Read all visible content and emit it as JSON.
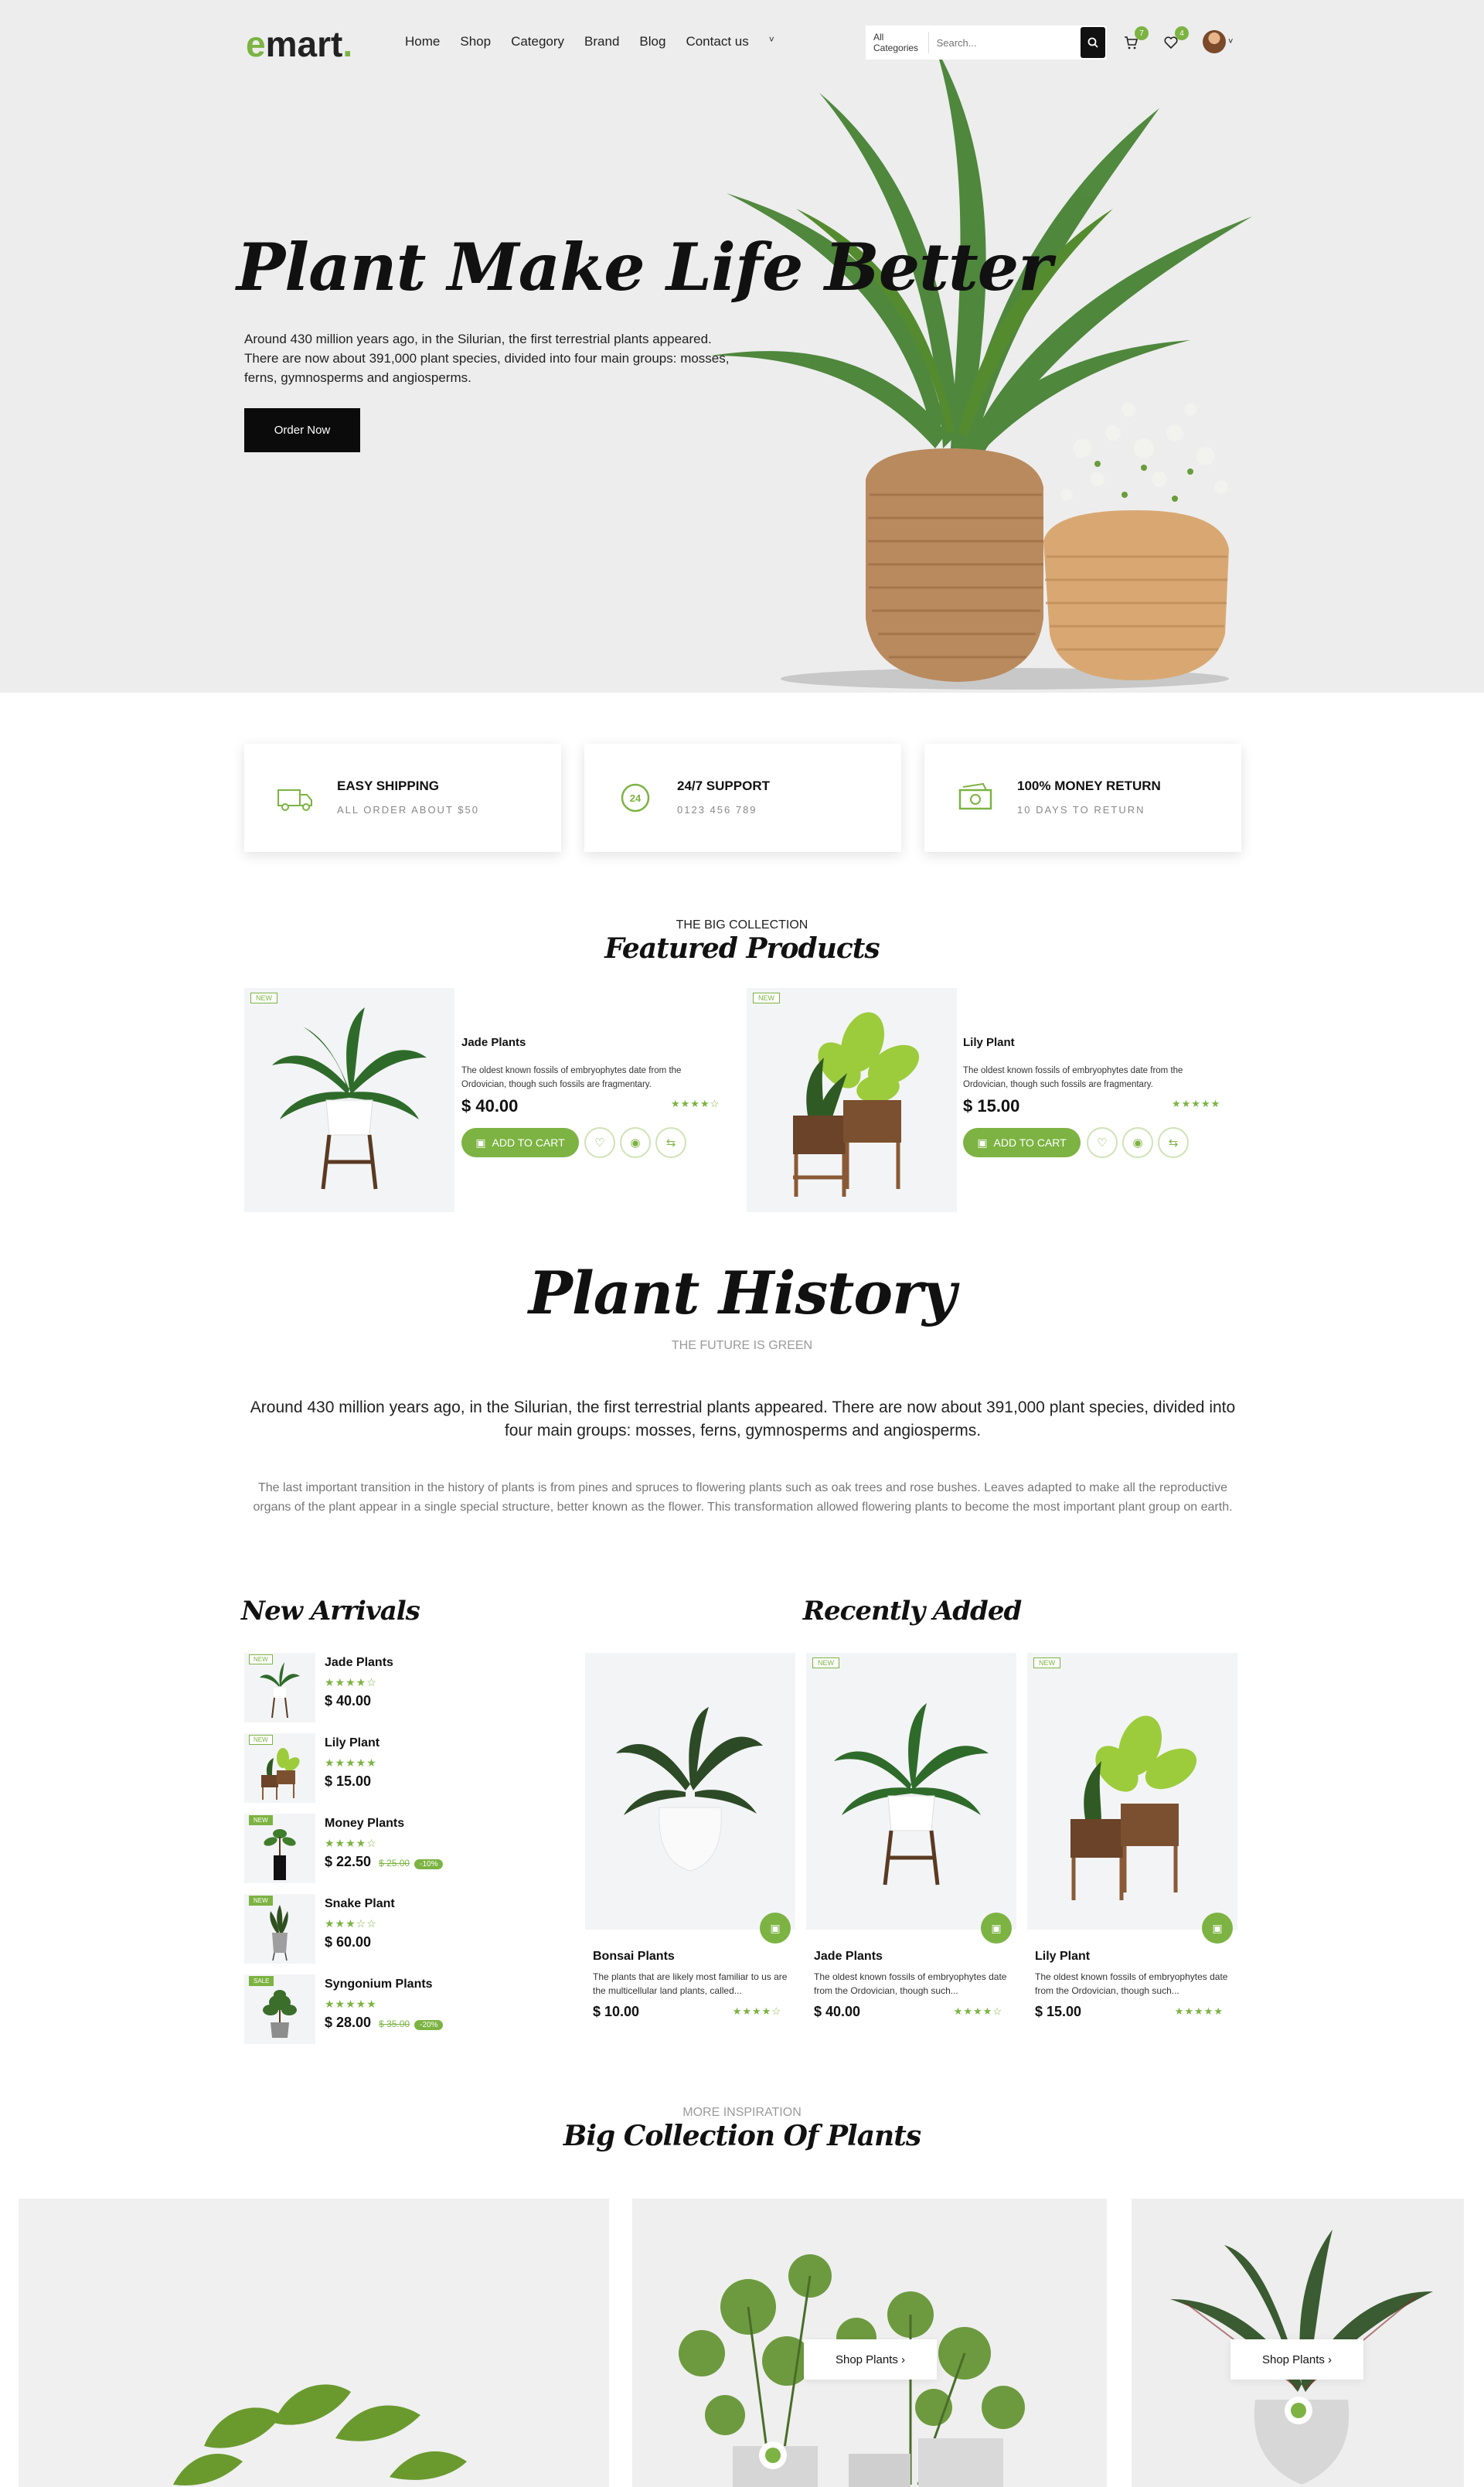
{
  "header": {
    "logo_e": "e",
    "logo_rest": "mart",
    "logo_dot": ".",
    "nav": [
      "Home",
      "Shop",
      "Category",
      "Brand",
      "Blog",
      "Contact us"
    ],
    "nav_more": "˅",
    "search_category": "All Categories",
    "search_placeholder": "Search...",
    "cart_count": "7",
    "wishlist_count": "4",
    "avatar_caret": "˅"
  },
  "hero": {
    "title": "Plant Make Life Better",
    "text": "Around 430 million years ago, in the Silurian, the first terrestrial plants appeared. There are now about 391,000 plant species, divided into four main groups: mosses, ferns, gymnosperms and angiosperms.",
    "button": "Order Now"
  },
  "features": [
    {
      "title": "EASY SHIPPING",
      "sub": "ALL ORDER ABOUT $50",
      "icon": "truck-icon"
    },
    {
      "title": "24/7 SUPPORT",
      "sub": "0123 456 789",
      "icon": "support-24-icon"
    },
    {
      "title": "100% MONEY RETURN",
      "sub": "10 DAYS TO RETURN",
      "icon": "money-icon"
    }
  ],
  "featured": {
    "eyebrow": "THE BIG COLLECTION",
    "title": "Featured Products",
    "products": [
      {
        "tag": "NEW",
        "name": "Jade Plants",
        "desc": "The oldest known fossils of embryophytes date from the Ordovician, though such fossils are fragmentary.",
        "price": "$ 40.00",
        "stars": "★★★★☆",
        "cart": "ADD TO CART"
      },
      {
        "tag": "NEW",
        "name": "Lily Plant",
        "desc": "The oldest known fossils of embryophytes date from the Ordovician, though such fossils are fragmentary.",
        "price": "$ 15.00",
        "stars": "★★★★★",
        "cart": "ADD TO CART"
      }
    ]
  },
  "history": {
    "title": "Plant History",
    "sub": "THE FUTURE IS GREEN",
    "lead": "Around 430 million years ago, in the Silurian, the first terrestrial plants appeared. There are now about 391,000 plant species, divided into four main groups: mosses, ferns, gymnosperms and angiosperms.",
    "body": "The last important transition in the history of plants is from pines and spruces to flowering plants such as oak trees and rose bushes. Leaves adapted to make all the reproductive organs of the plant appear in a single special structure, better known as the flower. This transformation allowed flowering plants to become the most important plant group on earth."
  },
  "new_arrivals": {
    "title": "New Arrivals",
    "items": [
      {
        "tag": "NEW",
        "name": "Jade Plants",
        "stars": "★★★★☆",
        "price": "$ 40.00",
        "old": "",
        "off": ""
      },
      {
        "tag": "NEW",
        "name": "Lily Plant",
        "stars": "★★★★★",
        "price": "$ 15.00",
        "old": "",
        "off": ""
      },
      {
        "tag": "NEW",
        "name": "Money Plants",
        "stars": "★★★★☆",
        "price": "$ 22.50",
        "old": "$ 25.00",
        "off": "-10%"
      },
      {
        "tag": "NEW",
        "name": "Snake Plant",
        "stars": "★★★☆☆",
        "price": "$ 60.00",
        "old": "",
        "off": ""
      },
      {
        "tag": "SALE",
        "name": "Syngonium Plants",
        "stars": "★★★★★",
        "price": "$ 28.00",
        "old": "$ 35.00",
        "off": "-20%"
      }
    ]
  },
  "recently": {
    "title": "Recently Added",
    "items": [
      {
        "tag": "",
        "name": "Bonsai Plants",
        "desc": "The plants that are likely most familiar to us are the multicellular land plants, called...",
        "price": "$ 10.00",
        "stars": "★★★★☆"
      },
      {
        "tag": "NEW",
        "name": "Jade Plants",
        "desc": "The oldest known fossils of embryophytes date from the Ordovician, though such...",
        "price": "$ 40.00",
        "stars": "★★★★☆"
      },
      {
        "tag": "NEW",
        "name": "Lily Plant",
        "desc": "The oldest known fossils of embryophytes date from the Ordovician, though such...",
        "price": "$ 15.00",
        "stars": "★★★★★"
      }
    ]
  },
  "collection": {
    "eyebrow": "MORE INSPIRATION",
    "title": "Big Collection Of Plants",
    "button": "Shop Plants ›"
  },
  "colors": {
    "accent": "#7cb342",
    "hero_bg": "#ededed",
    "dark": "#0b0b0b"
  }
}
